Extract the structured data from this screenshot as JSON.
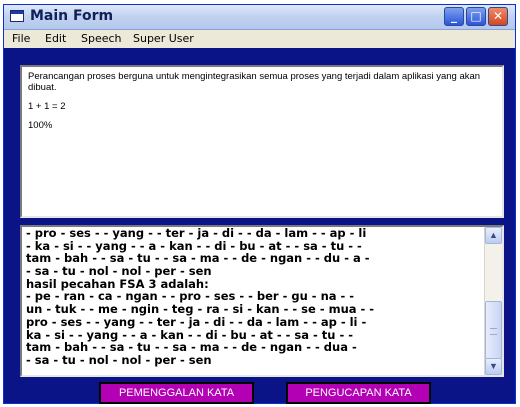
{
  "window": {
    "title": "Main Form"
  },
  "menu": [
    "File",
    "Edit",
    "Speech",
    "Super User"
  ],
  "top_panel": {
    "description": "Perancangan proses berguna untuk mengintegrasikan semua proses yang terjadi dalam aplikasi yang akan dibuat.",
    "equation": "1 + 1 = 2",
    "percent": "100%"
  },
  "output_lines": [
    "- pro - ses -   - yang -   - ter - ja - di -   - da - lam -   - ap - li",
    "- ka - si -   - yang -   - a - kan -   - di - bu - at -   - sa - tu -   -",
    "tam - bah -   - sa - tu -   - sa - ma -   - de - ngan -   - du - a -",
    "- sa - tu - nol - nol - per - sen",
    "hasil pecahan FSA 3 adalah:",
    " - pe - ran - ca - ngan -   - pro - ses -   - ber - gu - na -   -",
    "un - tuk -   - me - ngin - teg - ra - si - kan -   - se - mua -   -",
    "pro - ses -   - yang -   - ter - ja - di -   - da - lam -   - ap - li -",
    "ka - si -   - yang -   - a - kan -   - di - bu - at -   - sa - tu -   -",
    "tam - bah -   - sa - tu -   - sa - ma -   - de - ngan -   - dua -",
    "- sa - tu - nol - nol - per - sen"
  ],
  "buttons": {
    "segmentation": "PEMENGGALAN KATA",
    "pronunciation": "PENGUCAPAN KATA"
  },
  "colors": {
    "form_background": "#0a1486",
    "button_background": "#b400b4"
  }
}
